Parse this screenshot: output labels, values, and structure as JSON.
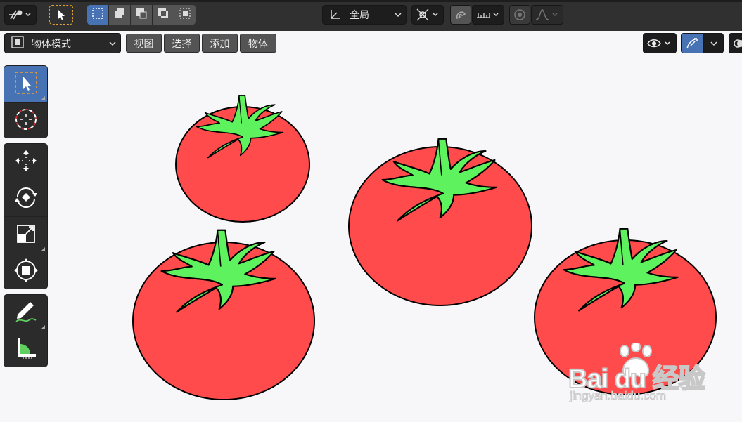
{
  "header": {
    "transform_orientation": "全局"
  },
  "subheader": {
    "mode": "物体模式",
    "menus": [
      "视图",
      "选择",
      "添加",
      "物体"
    ]
  },
  "toolbar": {
    "tools": [
      "select-box",
      "cursor",
      "move",
      "rotate",
      "scale",
      "transform",
      "annotate",
      "measure"
    ]
  },
  "watermark": {
    "brand": "Bai du 经验",
    "site": "jingyan.baidu.com"
  },
  "colors": {
    "tomato": "#ff4b4b",
    "stem": "#5ff25f",
    "accent": "#4772b3"
  }
}
